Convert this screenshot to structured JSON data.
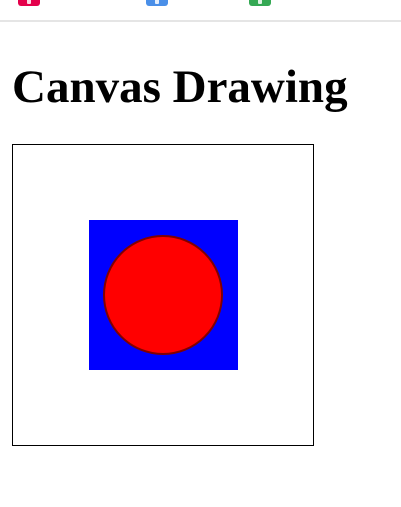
{
  "browser_bar": {
    "icons": [
      "app-icon-red",
      "app-icon-blue",
      "app-icon-green"
    ],
    "colors": {
      "red": "#e4004b",
      "blue": "#4a8fe8",
      "green": "#34a853"
    }
  },
  "page": {
    "title": "Canvas Drawing"
  },
  "canvas": {
    "colors": {
      "border": "#000000",
      "square_fill": "#0000ff",
      "circle_fill": "#ff0000",
      "circle_stroke": "#800000"
    }
  }
}
